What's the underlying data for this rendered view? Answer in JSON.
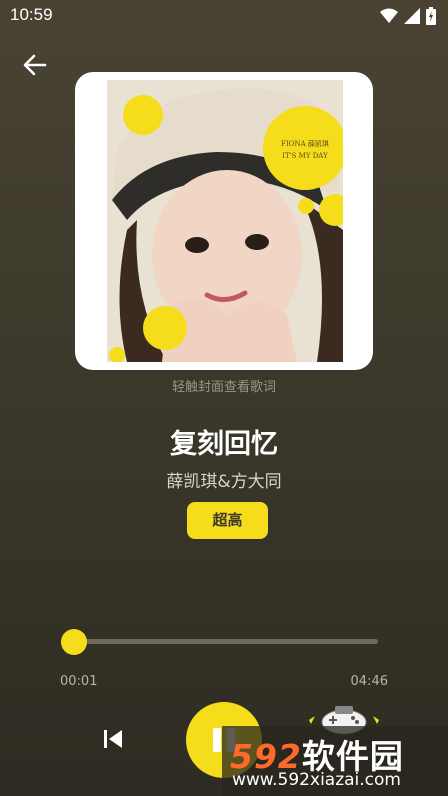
{
  "status_bar": {
    "time": "10:59"
  },
  "player": {
    "cover_hint": "轻触封面查看歌词",
    "title": "复刻回忆",
    "artist": "薛凯琪&方大同",
    "quality": "超高",
    "time_current": "00:01",
    "time_total": "04:46",
    "progress": 0.003
  },
  "cover": {
    "stamp_line1": "FIONA 薛凯琪",
    "stamp_line2": "IT'S MY DAY"
  },
  "watermark": {
    "logo_num": "592",
    "logo_text": "软件园",
    "url": "www.592xiazai.com"
  },
  "colors": {
    "accent": "#f5dd1c",
    "background": "#3d3a2c",
    "watermark_orange": "#ff6a2c"
  },
  "icons": [
    "back-arrow-icon",
    "wifi-icon",
    "signal-icon",
    "battery-icon",
    "previous-track-icon",
    "pause-icon",
    "game-controller-icon"
  ]
}
